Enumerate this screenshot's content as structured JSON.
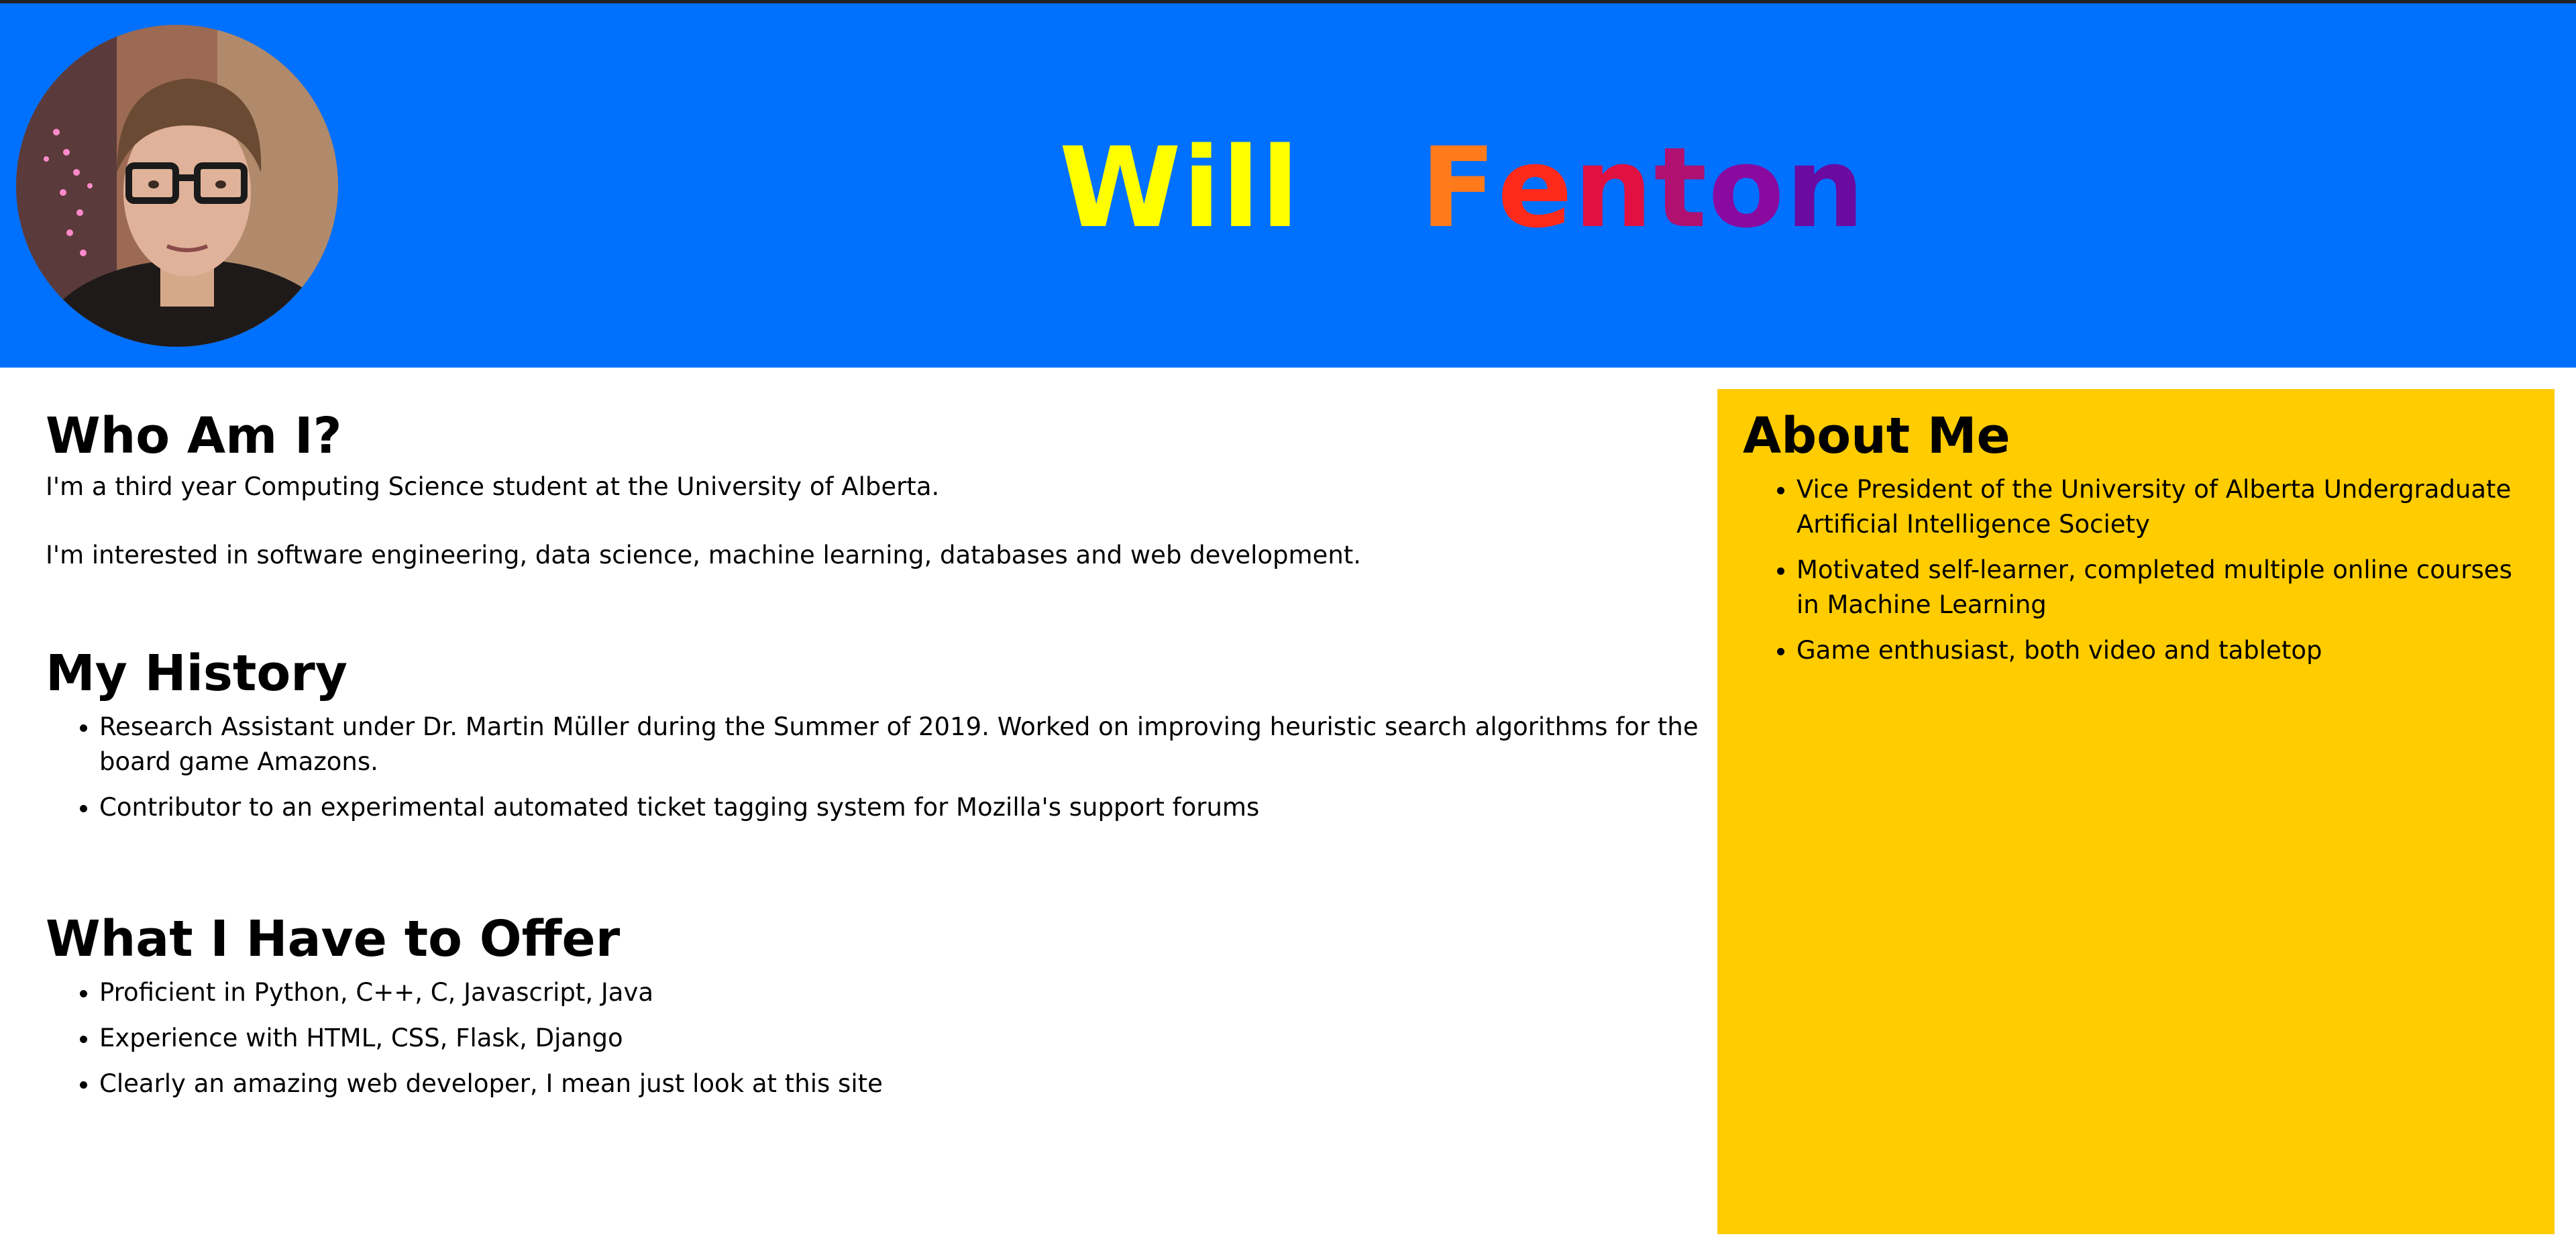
{
  "header": {
    "name_first": "Will",
    "name_last_letters": [
      "F",
      "e",
      "n",
      "t",
      "o",
      "n"
    ],
    "colors": {
      "background": "#0070ff",
      "first_name": "#ffff00",
      "last_name": [
        "#ff7a1a",
        "#ff2a1a",
        "#e01040",
        "#b01070",
        "#8a0aa0",
        "#6a0aa0"
      ]
    },
    "avatar_icon": "profile-photo"
  },
  "main": {
    "who": {
      "heading": "Who Am I?",
      "p1": "I'm a third year Computing Science student at the University of Alberta.",
      "p2": "I'm interested in software engineering, data science, machine learning, databases and web development."
    },
    "history": {
      "heading": "My History",
      "items": [
        "Research Assistant under Dr. Martin Müller during the Summer of 2019. Worked on improving heuristic search algorithms for the board game Amazons.",
        "Contributor to an experimental automated ticket tagging system for Mozilla's support forums"
      ]
    },
    "offer": {
      "heading": "What I Have to Offer",
      "items": [
        "Proficient in Python, C++, C, Javascript, Java",
        "Experience with HTML, CSS, Flask, Django",
        "Clearly an amazing web developer, I mean just look at this site"
      ]
    }
  },
  "aside": {
    "heading": "About Me",
    "background": "#ffcc00",
    "items": [
      "Vice President of the University of Alberta Undergraduate Artificial Intelligence Society",
      "Motivated self-learner, completed multiple online courses in Machine Learning",
      "Game enthusiast, both video and tabletop"
    ]
  }
}
